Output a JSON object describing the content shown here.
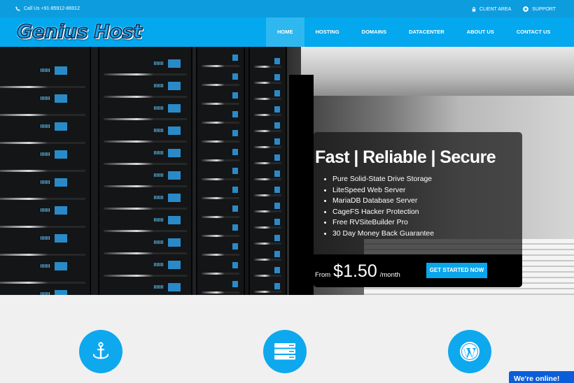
{
  "topbar": {
    "call_text": "Call Us +91-85912-86912",
    "client_area": "CLIENT AREA",
    "support": "SUPPORT",
    "icons": [
      "phone-icon",
      "lock-icon",
      "plus-circle-icon"
    ]
  },
  "header": {
    "logo_text": "Genius Host",
    "nav": [
      {
        "label": "HOME",
        "active": true
      },
      {
        "label": "HOSTING",
        "active": false
      },
      {
        "label": "DOMAINS",
        "active": false
      },
      {
        "label": "DATACENTER",
        "active": false
      },
      {
        "label": "ABOUT US",
        "active": false
      },
      {
        "label": "CONTACT US",
        "active": false
      }
    ]
  },
  "hero": {
    "headline": "Fast | Reliable | Secure",
    "features": [
      "Pure Solid-State Drive Storage",
      "LiteSpeed Web Server",
      "MariaDB Database Server",
      "CageFS Hacker Protection",
      "Free RVSiteBuilder Pro",
      "30 Day Money Back Guarantee"
    ],
    "price_prefix": "From",
    "price": "$1.50",
    "price_suffix": "/month",
    "cta_label": "GET STARTED NOW"
  },
  "feature_icons": [
    "anchor-icon",
    "server-icon",
    "wordpress-icon"
  ],
  "chat": {
    "label": "We're online!"
  },
  "colors": {
    "topbar": "#0d9ddf",
    "navbar": "#03a8ee",
    "nav_active": "#2fb8f0",
    "accent": "#09a6ec",
    "chat": "#0b5ed8"
  }
}
